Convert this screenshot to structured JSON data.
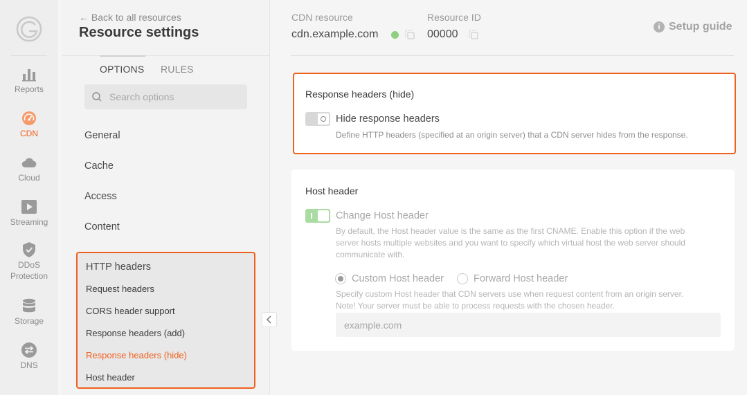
{
  "rail": {
    "items": [
      {
        "label": "Reports",
        "icon": "bar-chart-icon"
      },
      {
        "label": "CDN",
        "icon": "speedometer-icon"
      },
      {
        "label": "Cloud",
        "icon": "cloud-icon"
      },
      {
        "label": "Streaming",
        "icon": "play-icon"
      },
      {
        "label": "DDoS",
        "label2": "Protection",
        "icon": "shield-icon"
      },
      {
        "label": "Storage",
        "icon": "database-icon"
      },
      {
        "label": "DNS",
        "icon": "dns-arrows-icon"
      }
    ],
    "active": "CDN",
    "accent": "#f0601e"
  },
  "sidebar": {
    "back_link": "← Back to all resources",
    "title": "Resource settings",
    "tabs": [
      {
        "label": "OPTIONS"
      },
      {
        "label": "RULES"
      }
    ],
    "search_placeholder": "Search options",
    "nav": [
      {
        "label": "General"
      },
      {
        "label": "Cache"
      },
      {
        "label": "Access"
      },
      {
        "label": "Content"
      }
    ],
    "http_group": {
      "title": "HTTP headers",
      "items": [
        {
          "label": "Request headers"
        },
        {
          "label": "CORS header support"
        },
        {
          "label": "Response headers (add)"
        },
        {
          "label": "Response headers (hide)"
        },
        {
          "label": "Host header"
        }
      ],
      "active": "Response headers (hide)"
    }
  },
  "header": {
    "cdn_label": "CDN resource",
    "cdn_value": "cdn.example.com",
    "id_label": "Resource ID",
    "id_value": "00000",
    "setup_guide": "Setup guide",
    "status_color": "#8dd07f"
  },
  "response_hide": {
    "title": "Response headers (hide)",
    "toggle_label": "Hide response headers",
    "toggle_on": false,
    "description": "Define HTTP headers (specified at an origin server) that a CDN server hides from the response."
  },
  "host_header": {
    "title": "Host header",
    "toggle_label": "Change Host header",
    "toggle_on": true,
    "description_lines": [
      "By default, the Host header value is the same as the first CNAME. Enable this option if the web",
      "server hosts multiple websites and you want to specify which virtual host the web server should",
      "communicate with."
    ],
    "radio_custom": "Custom Host header",
    "radio_forward": "Forward Host header",
    "selected": "Custom Host header",
    "note_lines": [
      "Specify custom Host header that CDN servers use when request content from an origin server.",
      "Note! Your server must be able to process requests with the chosen header."
    ],
    "input_value": "example.com"
  }
}
